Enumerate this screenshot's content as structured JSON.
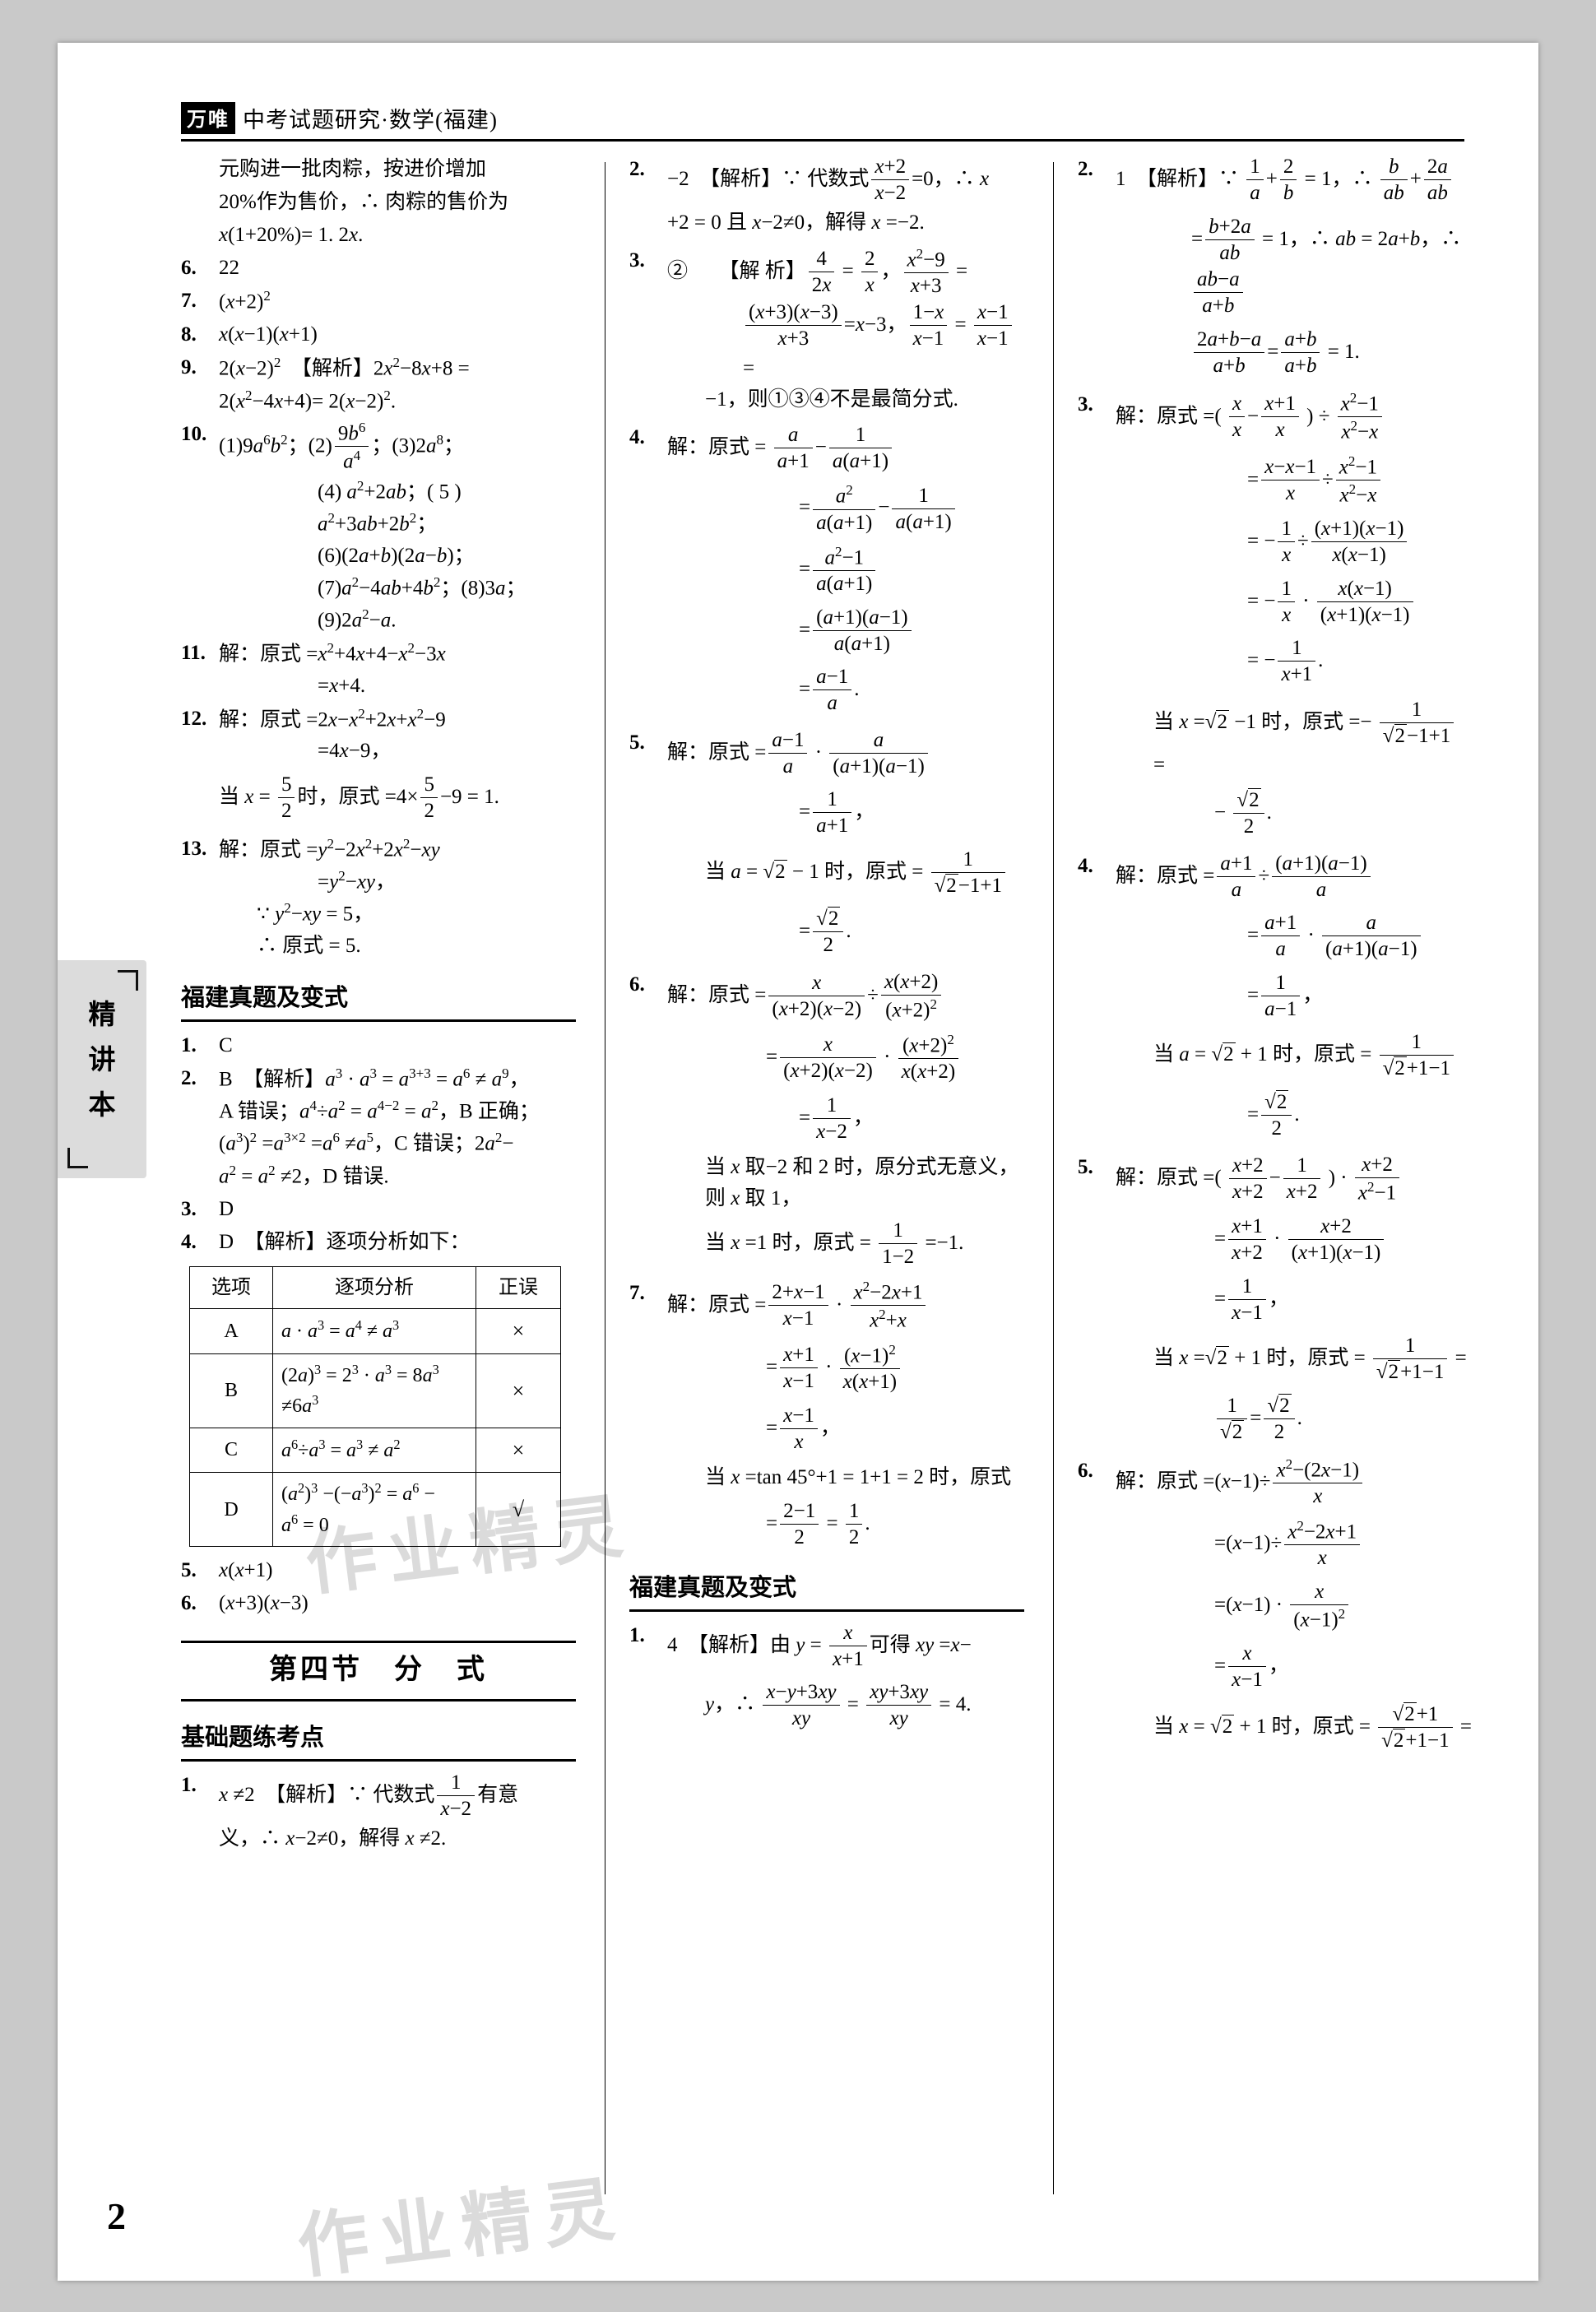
{
  "header": {
    "logo": "万唯",
    "title": "中考试题研究·数学(福建)"
  },
  "side_tab": {
    "text": "精讲本"
  },
  "page_number": "2",
  "watermark": "作业精灵",
  "column1": {
    "top_paragraph": [
      "元购进一批肉粽，按进价增加",
      "20%作为售价，∴ 肉粽的售价为",
      "x(1+20%)= 1. 2x."
    ],
    "items": [
      {
        "num": "6.",
        "lines": [
          "22"
        ]
      },
      {
        "num": "7.",
        "lines": [
          "(x+2)²"
        ]
      },
      {
        "num": "8.",
        "lines": [
          "x(x−1)(x+1)"
        ]
      },
      {
        "num": "9.",
        "lines": [
          "2(x−2)²　【解析】2x²−8x+8 =",
          "2(x²−4x+4)= 2(x−2)²."
        ]
      },
      {
        "num": "10.",
        "lines": [
          "(1)9a⁶b²；(2) 9b⁶/a⁴ ；(3)2a⁸；",
          "(4) a²+2ab；( 5 ) a²+3ab+2b²；",
          "(6)(2a+b)(2a−b)；",
          "(7)a²−4ab+4b²；(8)3a；",
          "(9)2a²−a."
        ]
      },
      {
        "num": "11.",
        "lines": [
          "解：原式 =x²+4x+4−x²−3x",
          "=x+4."
        ]
      },
      {
        "num": "12.",
        "lines": [
          "解：原式 =2x−x²+2x+x²−9",
          "=4x−9，",
          "当 x = 5/2 时，原式 =4× 5/2 −9 = 1."
        ]
      },
      {
        "num": "13.",
        "lines": [
          "解：原式 =y²−2x²+2x²−xy",
          "=y²−xy，",
          "∵ y²−xy = 5，",
          "∴ 原式 = 5."
        ]
      }
    ],
    "section_title": "福建真题及变式",
    "items2": [
      {
        "num": "1.",
        "lines": [
          "C"
        ]
      },
      {
        "num": "2.",
        "lines": [
          "B　【解析】a³ · a³ = a³⁺³ = a⁶ ≠ a⁹，",
          "A 错误；a⁴÷a² = a⁴⁻² = a²，B 正确；",
          "(a³)² =a³ˣ² =a⁶ ≠a⁵，C 错误；2a²−",
          "a² = a² ≠2，D 错误."
        ]
      },
      {
        "num": "3.",
        "lines": [
          "D"
        ]
      },
      {
        "num": "4.",
        "lines": [
          "D　【解析】逐项分析如下："
        ]
      }
    ],
    "table": {
      "headers": [
        "选项",
        "逐项分析",
        "正误"
      ],
      "rows": [
        {
          "opt": "A",
          "analysis": "a · a³ = a⁴ ≠ a³",
          "mark": "×"
        },
        {
          "opt": "B",
          "analysis": "(2a)³ = 2³ · a³ = 8a³ ≠6a³",
          "mark": "×"
        },
        {
          "opt": "C",
          "analysis": "a⁶÷a³ = a³ ≠ a²",
          "mark": "×"
        },
        {
          "opt": "D",
          "analysis": "(a²)³ −(−a³)² = a⁶ − a⁶ = 0",
          "mark": "√"
        }
      ]
    },
    "items3": [
      {
        "num": "5.",
        "lines": [
          "x(x+1)"
        ]
      },
      {
        "num": "6.",
        "lines": [
          "(x+3)(x−3)"
        ]
      }
    ],
    "chapter_title": "第四节　分　式",
    "sub_title": "基础题练考点",
    "items4": [
      {
        "num": "1.",
        "lines": [
          "x ≠2　【解析】∵ 代数式 1/(x−2) 有意",
          "义，∴ x−2≠0，解得 x ≠2."
        ]
      }
    ]
  },
  "column2": {
    "items": [
      {
        "num": "2.",
        "lines": [
          "−2　【解析】∵ 代数式 (x+2)/(x−2) =0，∴ x",
          "+2 = 0 且 x−2≠0，解得 x =−2."
        ]
      },
      {
        "num": "3.",
        "lines": [
          "②　　【解析】 4/2x = 2/x ， (x²−9)/(x+3) =",
          "((x+3)(x−3))/(x+3) =x−3， (1−x)/(x−1) = (x−1)/(x−1) =",
          "−1，则①③④不是最简分式."
        ]
      },
      {
        "num": "4.",
        "lines": [
          "解：原式 = a/(a+1) − 1/(a(a+1))",
          "= a²/(a(a+1)) − 1/(a(a+1))",
          "= (a²−1)/(a(a+1))",
          "= ((a+1)(a−1))/(a(a+1))",
          "= (a−1)/a ."
        ]
      },
      {
        "num": "5.",
        "lines": [
          "解：原式 = (a−1)/a · a/((a+1)(a−1))",
          "= 1/(a+1)，",
          "当 a = √2 − 1 时，原式 = 1/(√2−1+1)",
          "= √2/2 ."
        ]
      },
      {
        "num": "6.",
        "lines": [
          "解：原式 = x/((x+2)(x−2)) ÷ (x(x+2))/((x+2)²)",
          "= x/((x+2)(x−2)) · ((x+2)²)/(x(x+2))",
          "= 1/(x−2)，",
          "当 x 取−2 和 2 时，原分式无意义，",
          "则 x 取 1，",
          "当 x =1 时，原式 = 1/(1−2) =−1."
        ]
      },
      {
        "num": "7.",
        "lines": [
          "解：原式 = (2+x−1)/(x−1) · (x²−2x+1)/(x²+x)",
          "= (x+1)/(x−1) · ((x−1)²)/(x(x+1))",
          "= (x−1)/x ，",
          "当 x =tan 45°+1 = 1+1 = 2 时，原式",
          "= (2−1)/2 = 1/2 ."
        ]
      }
    ],
    "section_title": "福建真题及变式",
    "items2": [
      {
        "num": "1.",
        "lines": [
          "4　【解析】由 y = x/(x+1) 可得 xy =x−",
          "y，∴ (x−y+3xy)/xy = (xy+3xy)/xy = 4."
        ]
      }
    ]
  },
  "column3": {
    "items": [
      {
        "num": "2.",
        "lines": [
          "1　【解析】∵ 1/a + 2/b = 1，∴ b/ab + 2a/ab",
          "= (b+2a)/ab = 1，∴ ab = 2a+b，∴ (ab−a)/(a+b)",
          "(2a+b−a)/(a+b) = (a+b)/(a+b) = 1."
        ]
      },
      {
        "num": "3.",
        "lines": [
          "解：原式 =( x/x − (x+1)/x ) ÷ (x²−1)/(x²−x)",
          "= (x−x−1)/x ÷ (x²−1)/(x²−x)",
          "= − 1/x ÷ ((x+1)(x−1))/(x(x−1))",
          "= − 1/x · (x(x−1))/((x+1)(x−1))",
          "= − 1/(x+1) .",
          "当 x =√2 −1 时，原式 =− 1/(√2−1+1) =",
          "− √2/2 ."
        ]
      },
      {
        "num": "4.",
        "lines": [
          "解：原式 = (a+1)/a ÷ ((a+1)(a−1))/a",
          "= (a+1)/a · a/((a+1)(a−1))",
          "= 1/(a−1)，",
          "当 a = √2 + 1 时，原式 = 1/(√2+1−1)",
          "= √2/2 ."
        ]
      },
      {
        "num": "5.",
        "lines": [
          "解：原式 =( (x+2)/(x+2) − 1/(x+2) ) · (x+2)/(x²−1)",
          "= (x+1)/(x+2) · (x+2)/((x+1)(x−1))",
          "= 1/(x−1)，",
          "当 x =√2 + 1 时，原式 = 1/(√2+1−1) =",
          "1/√2 = √2/2 ."
        ]
      },
      {
        "num": "6.",
        "lines": [
          "解：原式 =(x−1)÷ (x²−(2x−1))/x",
          "=(x−1)÷ (x²−2x+1)/x",
          "=(x−1) · x/((x−1)²)",
          "= x/(x−1) ，",
          "当 x = √2 + 1 时，原式 = (√2+1)/(√2+1−1) ="
        ]
      }
    ]
  }
}
